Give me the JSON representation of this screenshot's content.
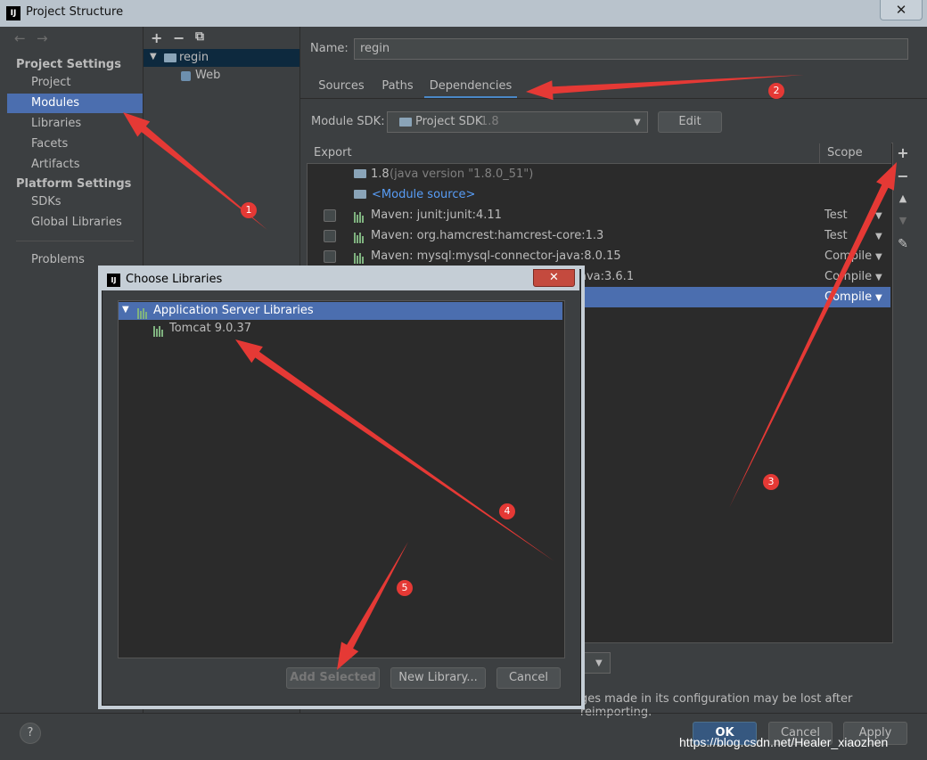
{
  "window": {
    "title": "Project Structure",
    "close_glyph": "✕"
  },
  "nav": {
    "back": "←",
    "forward": "→",
    "project_settings_header": "Project Settings",
    "project_settings": [
      "Project",
      "Modules",
      "Libraries",
      "Facets",
      "Artifacts"
    ],
    "platform_settings_header": "Platform Settings",
    "platform_settings": [
      "SDKs",
      "Global Libraries"
    ],
    "problems": "Problems",
    "selected": "Modules"
  },
  "tree": {
    "toolbar": {
      "add": "+",
      "remove": "−",
      "copy": "⧉"
    },
    "module": "regin",
    "facet": "Web"
  },
  "module": {
    "name_label": "Name:",
    "name_value": "regin",
    "tabs": [
      "Sources",
      "Paths",
      "Dependencies"
    ],
    "active_tab": "Dependencies",
    "sdk_label": "Module SDK:",
    "sdk_value": "Project SDK",
    "sdk_version": "1.8",
    "edit_button": "Edit"
  },
  "dependencies": {
    "col_export": "Export",
    "col_scope": "Scope",
    "sdk_row": {
      "name": "1.8",
      "detail": "(java version \"1.8.0_51\")"
    },
    "module_source": "<Module source>",
    "rows": [
      {
        "name": "Maven: junit:junit:4.11",
        "scope": "Test"
      },
      {
        "name": "Maven: org.hamcrest:hamcrest-core:1.3",
        "scope": "Test"
      },
      {
        "name": "Maven: mysql:mysql-connector-java:8.0.15",
        "scope": "Compile"
      },
      {
        "name": "ava:3.6.1",
        "scope": "Compile"
      },
      {
        "name": "",
        "scope": "Compile"
      }
    ],
    "side_toolbar": {
      "add": "+",
      "remove": "−",
      "up": "▲",
      "down": "▼",
      "edit": "✎"
    }
  },
  "footer": {
    "warning": "ges made in its configuration may be lost after reimporting.",
    "help": "?",
    "ok": "OK",
    "cancel": "Cancel",
    "apply": "Apply"
  },
  "dialog": {
    "title": "Choose Libraries",
    "close_glyph": "✕",
    "group": "Application Server Libraries",
    "item": "Tomcat 9.0.37",
    "add_selected": "Add Selected",
    "new_library": "New Library...",
    "cancel": "Cancel"
  },
  "annotations": {
    "color": "#e53935",
    "badges": [
      "1",
      "2",
      "3",
      "4",
      "5"
    ]
  },
  "watermark": "https://blog.csdn.net/Healer_xiaozhen"
}
